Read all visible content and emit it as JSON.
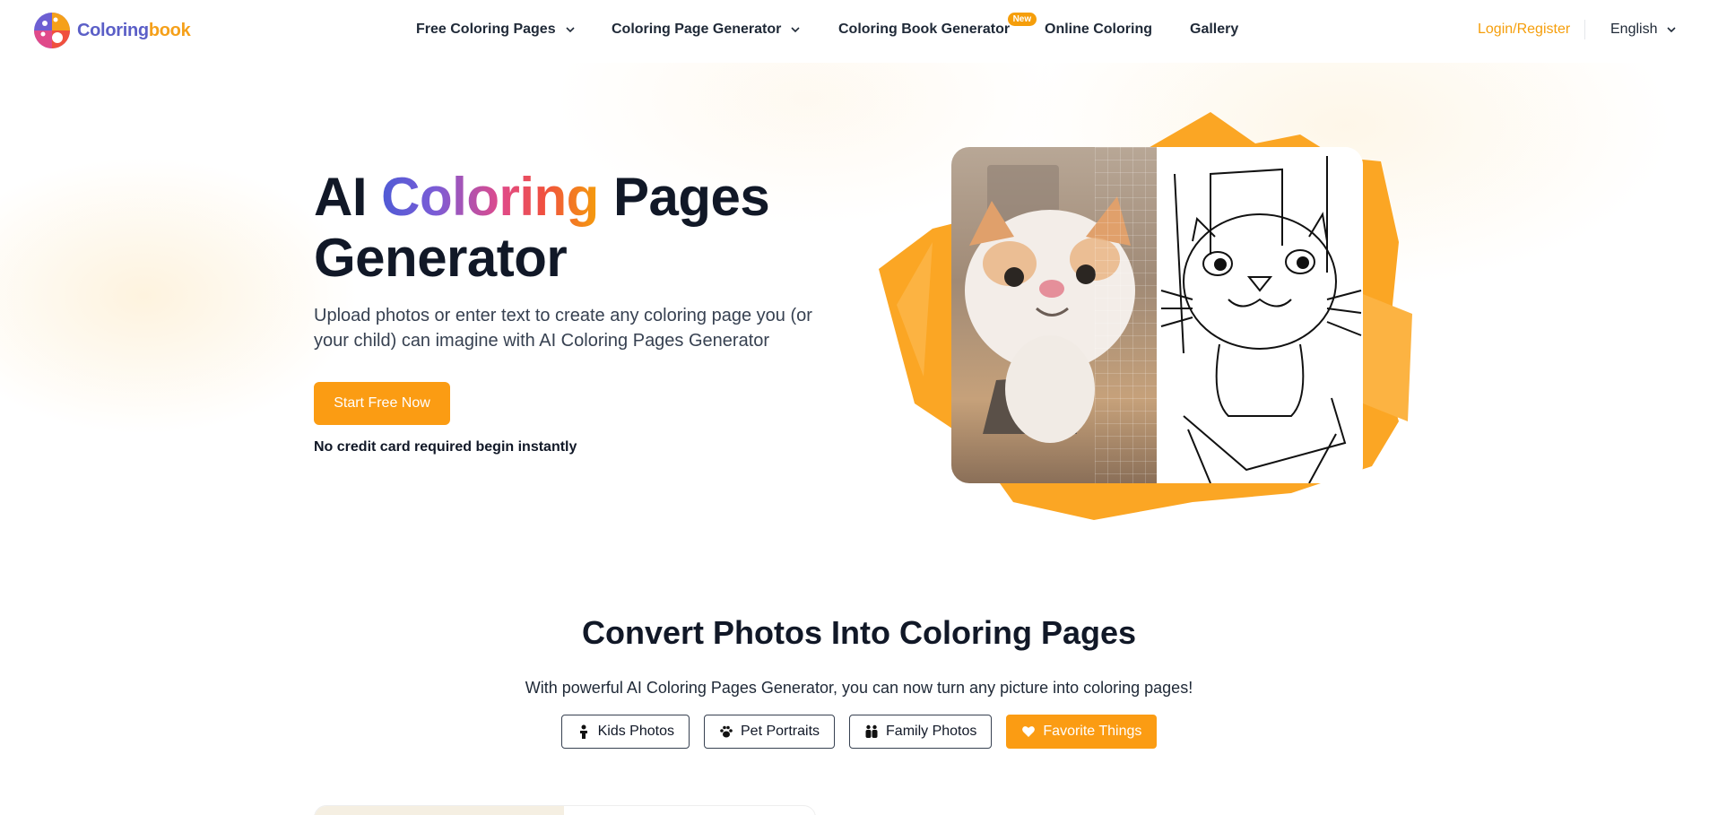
{
  "header": {
    "logo": {
      "part1": "Coloring",
      "part2": "book"
    },
    "nav": [
      {
        "label": "Free Coloring Pages",
        "dropdown": true
      },
      {
        "label": "Coloring Page Generator",
        "dropdown": true
      },
      {
        "label": "Coloring Book Generator",
        "badge": "New"
      },
      {
        "label": "Online Coloring"
      },
      {
        "label": "Gallery"
      }
    ],
    "login": "Login/Register",
    "language": "English"
  },
  "hero": {
    "title_prefix": "AI ",
    "title_highlight": "Coloring",
    "title_suffix": " Pages",
    "title_line2": "Generator",
    "description": "Upload photos or enter text to create any coloring page you (or your child) can imagine with AI Coloring Pages Generator",
    "cta": "Start Free Now",
    "cta_note": "No credit card required begin instantly"
  },
  "section": {
    "title": "Convert Photos Into Coloring Pages",
    "subtitle": "With powerful AI Coloring Pages Generator, you can now turn any picture into coloring pages!",
    "tabs": [
      {
        "label": "Kids Photos",
        "icon": "child-icon",
        "active": false
      },
      {
        "label": "Pet Portraits",
        "icon": "paw-icon",
        "active": false
      },
      {
        "label": "Family Photos",
        "icon": "family-icon",
        "active": false
      },
      {
        "label": "Favorite Things",
        "icon": "heart-icon",
        "active": true
      }
    ]
  },
  "colors": {
    "accent": "#fb9c13",
    "login": "#f59e0b",
    "logo_blue": "#5b5fc7"
  }
}
